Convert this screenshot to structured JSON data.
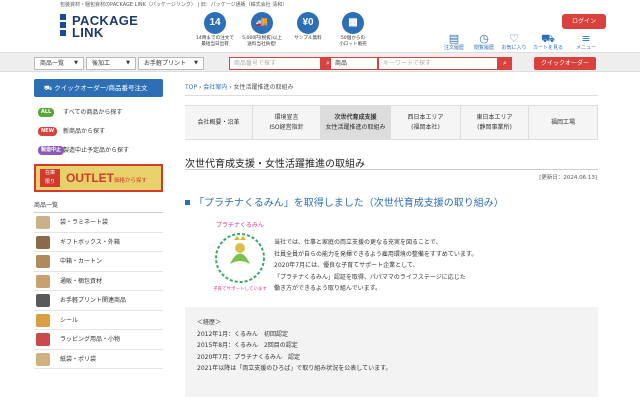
{
  "header": {
    "tagline": "包装資材・梱包資材のPACKAGE LINK（パッケージリンク） | 旧：パッケージ通販（株式会社 清和）",
    "logo_line1": "PACKAGE",
    "logo_line2": "LINK",
    "features": [
      {
        "icon": "clock-icon",
        "glyph": "14",
        "caption": "14時までの注文で\n最短当日出荷"
      },
      {
        "icon": "truck-icon",
        "glyph": "🚚",
        "caption": "5,000円(税抜)以上\n送料当社負担!"
      },
      {
        "icon": "yen-icon",
        "glyph": "¥0",
        "caption": "サンプル無料"
      },
      {
        "icon": "box-icon",
        "glyph": "▦",
        "caption": "50個からの\n小ロット販売"
      }
    ],
    "login_label": "ログイン",
    "icons": [
      {
        "name": "history-icon",
        "glyph": "▤",
        "label": "注文履歴"
      },
      {
        "name": "viewed-icon",
        "glyph": "◷",
        "label": "閲覧履歴"
      },
      {
        "name": "heart-icon",
        "glyph": "♡",
        "label": "お気に入り"
      },
      {
        "name": "cart-icon",
        "glyph": "⛟",
        "label": "カートを見る"
      },
      {
        "name": "menu-icon",
        "glyph": "≡",
        "label": "メニュー"
      }
    ]
  },
  "nav": {
    "list_label": "商品一覧",
    "process_label": "後加工",
    "print_label": "お手軽プリント",
    "code_select": "商品",
    "code_placeholder": "商品番号で探す",
    "kw_select": "商品",
    "kw_placeholder": "キーワードで探す",
    "quick_label": "クイックオーダー"
  },
  "sidebar": {
    "quick_order": "クイックオーダー/商品番号注文",
    "links": [
      {
        "badge": "ALL",
        "color": "#5aa63a",
        "label": "すべての商品から探す"
      },
      {
        "badge": "NEW",
        "color": "#d9413c",
        "label": "新商品から探す"
      },
      {
        "badge": "製造中止",
        "color": "#8a5ab8",
        "label": "製造中止予定品から探す"
      }
    ],
    "outlet_badge": "在庫\n限り",
    "outlet_title": "OUTLET",
    "outlet_sub": "価格から探す",
    "cat_heading": "商品一覧",
    "categories": [
      {
        "label": "袋・ラミネート袋",
        "color": "#c9b28a"
      },
      {
        "label": "ギフトボックス・外箱",
        "color": "#8a6a4a"
      },
      {
        "label": "中箱・カートン",
        "color": "#b08a5a"
      },
      {
        "label": "通販・梱包資材",
        "color": "#c9a070"
      },
      {
        "label": "お手軽プリント関連商品",
        "color": "#5a5a5a"
      },
      {
        "label": "シール",
        "color": "#d8a040"
      },
      {
        "label": "ラッピング用品・小物",
        "color": "#c84a4a"
      },
      {
        "label": "紙袋・ポリ袋",
        "color": "#d0b080"
      }
    ]
  },
  "breadcrumb": {
    "home": "TOP",
    "sep": "›",
    "company": "会社案内",
    "current": "女性活躍推進の取組み"
  },
  "tabs": [
    {
      "line1": "会社概要・沿革",
      "line2": "",
      "active": false
    },
    {
      "line1": "環境宣言",
      "line2": "ISO経営指針",
      "active": false
    },
    {
      "line1": "次世代育成支援",
      "line2": "女性活躍推進の取組み",
      "active": true
    },
    {
      "line1": "西日本エリア",
      "line2": "(福岡本社)",
      "active": false
    },
    {
      "line1": "東日本エリア",
      "line2": "(静岡事業所)",
      "active": false
    },
    {
      "line1": "福岡工場",
      "line2": "",
      "active": false
    }
  ],
  "content": {
    "title": "次世代育成支援・女性活躍推進の取組み",
    "updated": "[更新日：2024.06.13]",
    "heading": "「プラチナくるみん」を取得しました（次世代育成支援の取り組み）",
    "emblem_text": "プラチナくるみん",
    "emblem_sub": "子育てサポートしています",
    "body": "当社では、仕事と家庭の両立支援の更なる充実を図ることで、\n社員全員が自らの能力を発揮できるよう雇用環境の整備をすすめています。\n2020年7月には、優良な子育てサポート企業として、\n「プラチナくるみん」認証を取得、パパママのライフステージに応じた\n働き方ができるよう取り組んでいます。",
    "history": "＜経歴＞\n2012年1月：くるみん　初回認定\n2015年8月：くるみん　2回目の認定\n2020年7月：プラチナくるみん　認定\n2021年以降は「両立支援のひろば」で取り組み状況を公表しています。"
  }
}
